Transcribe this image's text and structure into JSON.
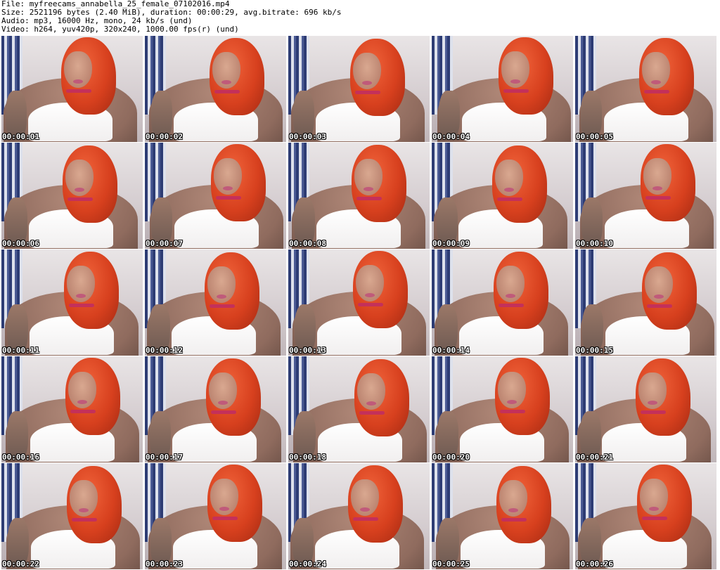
{
  "header": {
    "file": "File: myfreecams_annabella_25_female_07102016.mp4",
    "size": "Size: 2521196 bytes (2.40 MiB), duration: 00:00:29, avg.bitrate: 696 kb/s",
    "audio": "Audio: mp3, 16000 Hz, mono, 24 kb/s (und)",
    "video": "Video: h264, yuv420p, 320x240, 1000.00 fps(r) (und)"
  },
  "frames": [
    {
      "time": "00:00:01"
    },
    {
      "time": "00:00:02"
    },
    {
      "time": "00:00:03"
    },
    {
      "time": "00:00:04"
    },
    {
      "time": "00:00:05"
    },
    {
      "time": "00:00:06"
    },
    {
      "time": "00:00:07"
    },
    {
      "time": "00:00:08"
    },
    {
      "time": "00:00:09"
    },
    {
      "time": "00:00:10"
    },
    {
      "time": "00:00:11"
    },
    {
      "time": "00:00:12"
    },
    {
      "time": "00:00:13"
    },
    {
      "time": "00:00:14"
    },
    {
      "time": "00:00:15"
    },
    {
      "time": "00:00:16"
    },
    {
      "time": "00:00:17"
    },
    {
      "time": "00:00:18"
    },
    {
      "time": "00:00:20"
    },
    {
      "time": "00:00:21"
    },
    {
      "time": "00:00:22"
    },
    {
      "time": "00:00:23"
    },
    {
      "time": "00:00:24"
    },
    {
      "time": "00:00:25"
    },
    {
      "time": "00:00:26"
    }
  ]
}
